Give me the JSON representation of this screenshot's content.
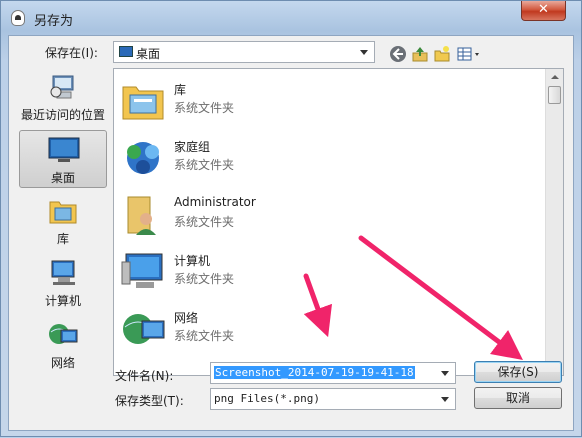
{
  "window": {
    "title": "另存为",
    "close_label": "✕"
  },
  "toolbar": {
    "save_in_label": "保存在(I):",
    "location": "桌面",
    "icons": [
      "back-icon",
      "up-folder-icon",
      "new-folder-icon",
      "view-menu-icon"
    ]
  },
  "sidebar": {
    "items": [
      {
        "label": "最近访问的位置",
        "icon": "recent-places-icon",
        "selected": false
      },
      {
        "label": "桌面",
        "icon": "desktop-icon",
        "selected": true
      },
      {
        "label": "库",
        "icon": "libraries-icon",
        "selected": false
      },
      {
        "label": "计算机",
        "icon": "computer-icon",
        "selected": false
      },
      {
        "label": "网络",
        "icon": "network-icon",
        "selected": false
      }
    ]
  },
  "files": [
    {
      "name": "库",
      "type": "系统文件夹",
      "icon": "libraries-icon"
    },
    {
      "name": "家庭组",
      "type": "系统文件夹",
      "icon": "homegroup-icon"
    },
    {
      "name": "Administrator",
      "type": "系统文件夹",
      "icon": "user-folder-icon"
    },
    {
      "name": "计算机",
      "type": "系统文件夹",
      "icon": "computer-icon"
    },
    {
      "name": "网络",
      "type": "系统文件夹",
      "icon": "network-icon"
    }
  ],
  "form": {
    "filename_label": "文件名(N):",
    "filename_value": "Screenshot_2014-07-19-19-41-18",
    "filetype_label": "保存类型(T):",
    "filetype_value": "png Files(*.png)",
    "save_button": "保存(S)",
    "cancel_button": "取消"
  },
  "colors": {
    "annotation_arrow": "#f0246a",
    "selection": "#3399ff",
    "selected_place": "#cfcfcf"
  }
}
